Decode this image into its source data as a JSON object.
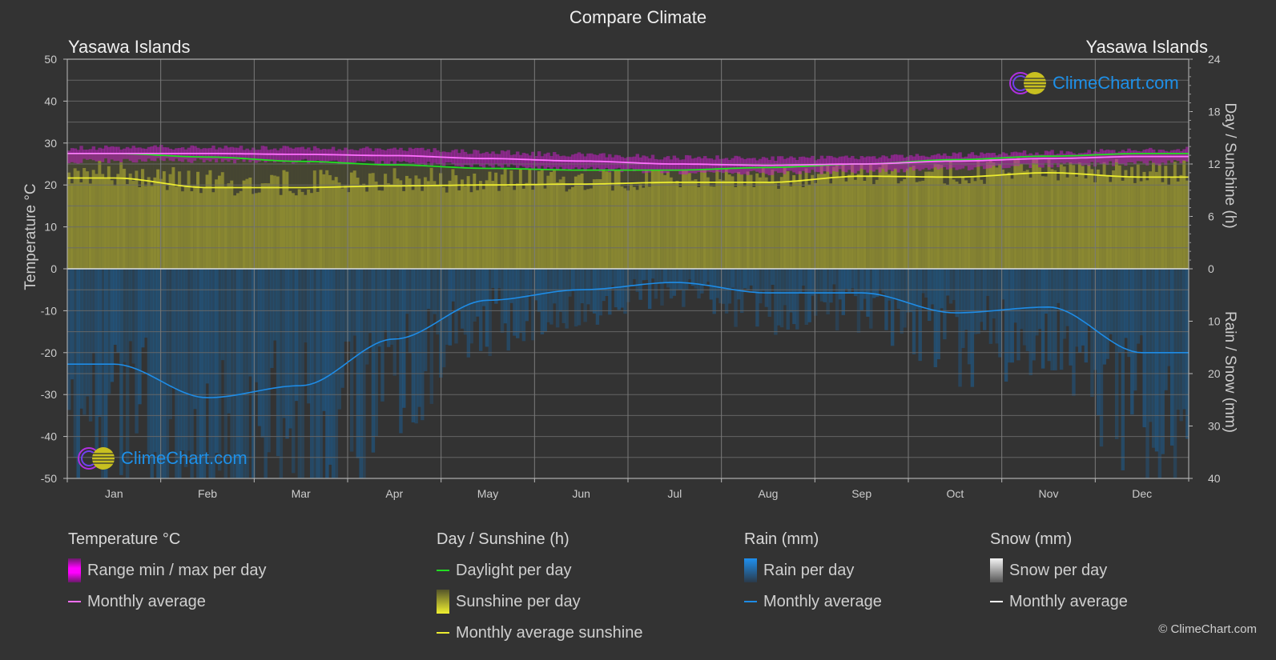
{
  "header": {
    "title": "Compare Climate",
    "location_left": "Yasawa Islands",
    "location_right": "Yasawa Islands"
  },
  "watermark": {
    "text": "ClimeChart.com"
  },
  "copyright": "© ClimeChart.com",
  "colors": {
    "background": "#333333",
    "temp_range": "#c020c0",
    "temp_avg": "#ff70ff",
    "daylight": "#22dd22",
    "sunshine_fill": "#8c8a32",
    "sunshine_avg": "#ecec30",
    "rain_fill": "#1e5a8a",
    "rain_avg": "#1e8ce6",
    "snow_avg": "#ffffff",
    "grid": "#6a6a6a",
    "axis_text": "#cccccc"
  },
  "legend": {
    "temperature": {
      "header": "Temperature °C",
      "items": [
        "Range min / max per day",
        "Monthly average"
      ]
    },
    "sunshine": {
      "header": "Day / Sunshine (h)",
      "items": [
        "Daylight per day",
        "Sunshine per day",
        "Monthly average sunshine"
      ]
    },
    "rain": {
      "header": "Rain (mm)",
      "items": [
        "Rain per day",
        "Monthly average"
      ]
    },
    "snow": {
      "header": "Snow (mm)",
      "items": [
        "Snow per day",
        "Monthly average"
      ]
    }
  },
  "chart_data": {
    "type": "line",
    "title": "Compare Climate",
    "categories": [
      "Jan",
      "Feb",
      "Mar",
      "Apr",
      "May",
      "Jun",
      "Jul",
      "Aug",
      "Sep",
      "Oct",
      "Nov",
      "Dec"
    ],
    "left_axis": {
      "label": "Temperature °C",
      "range": [
        -50,
        50
      ],
      "ticks": [
        "50",
        "40",
        "30",
        "20",
        "10",
        "0",
        "-10",
        "-20",
        "-30",
        "-40",
        "-50"
      ]
    },
    "right_axis_top": {
      "label": "Day / Sunshine (h)",
      "range": [
        0,
        24
      ],
      "ticks": [
        "24",
        "18",
        "12",
        "6",
        "0"
      ]
    },
    "right_axis_bottom": {
      "label": "Rain / Snow (mm)",
      "range": [
        0,
        40
      ],
      "ticks": [
        "0",
        "10",
        "20",
        "30",
        "40"
      ]
    },
    "grid": true,
    "series": [
      {
        "name": "Temperature monthly average (°C)",
        "axis": "left",
        "values": [
          27.5,
          27.5,
          27.3,
          27.0,
          26.3,
          25.7,
          25.0,
          24.7,
          25.0,
          25.7,
          26.3,
          26.8
        ]
      },
      {
        "name": "Temperature daily max (°C)",
        "axis": "left",
        "values": [
          29.0,
          29.0,
          28.8,
          28.5,
          27.8,
          27.2,
          26.6,
          26.3,
          26.6,
          27.2,
          27.8,
          28.3
        ]
      },
      {
        "name": "Temperature daily min (°C)",
        "axis": "left",
        "values": [
          25.8,
          25.8,
          25.6,
          25.2,
          24.5,
          23.8,
          23.1,
          22.9,
          23.3,
          24.0,
          24.7,
          25.2
        ]
      },
      {
        "name": "Daylight per day (h)",
        "axis": "right_top",
        "values": [
          13.2,
          12.8,
          12.3,
          11.9,
          11.5,
          11.3,
          11.3,
          11.6,
          12.0,
          12.5,
          12.9,
          13.2
        ]
      },
      {
        "name": "Monthly average sunshine (h)",
        "axis": "right_top",
        "values": [
          10.4,
          9.3,
          9.3,
          9.5,
          9.6,
          9.7,
          9.9,
          9.9,
          10.6,
          10.5,
          11.0,
          10.5
        ]
      },
      {
        "name": "Rain monthly average (mm)",
        "axis": "right_bottom",
        "values": [
          18.2,
          24.6,
          22.3,
          13.4,
          6.0,
          4.0,
          2.6,
          4.6,
          4.6,
          8.4,
          7.3,
          16.0
        ]
      },
      {
        "name": "Snow monthly average (mm)",
        "axis": "right_bottom",
        "values": [
          0,
          0,
          0,
          0,
          0,
          0,
          0,
          0,
          0,
          0,
          0,
          0
        ]
      }
    ]
  }
}
